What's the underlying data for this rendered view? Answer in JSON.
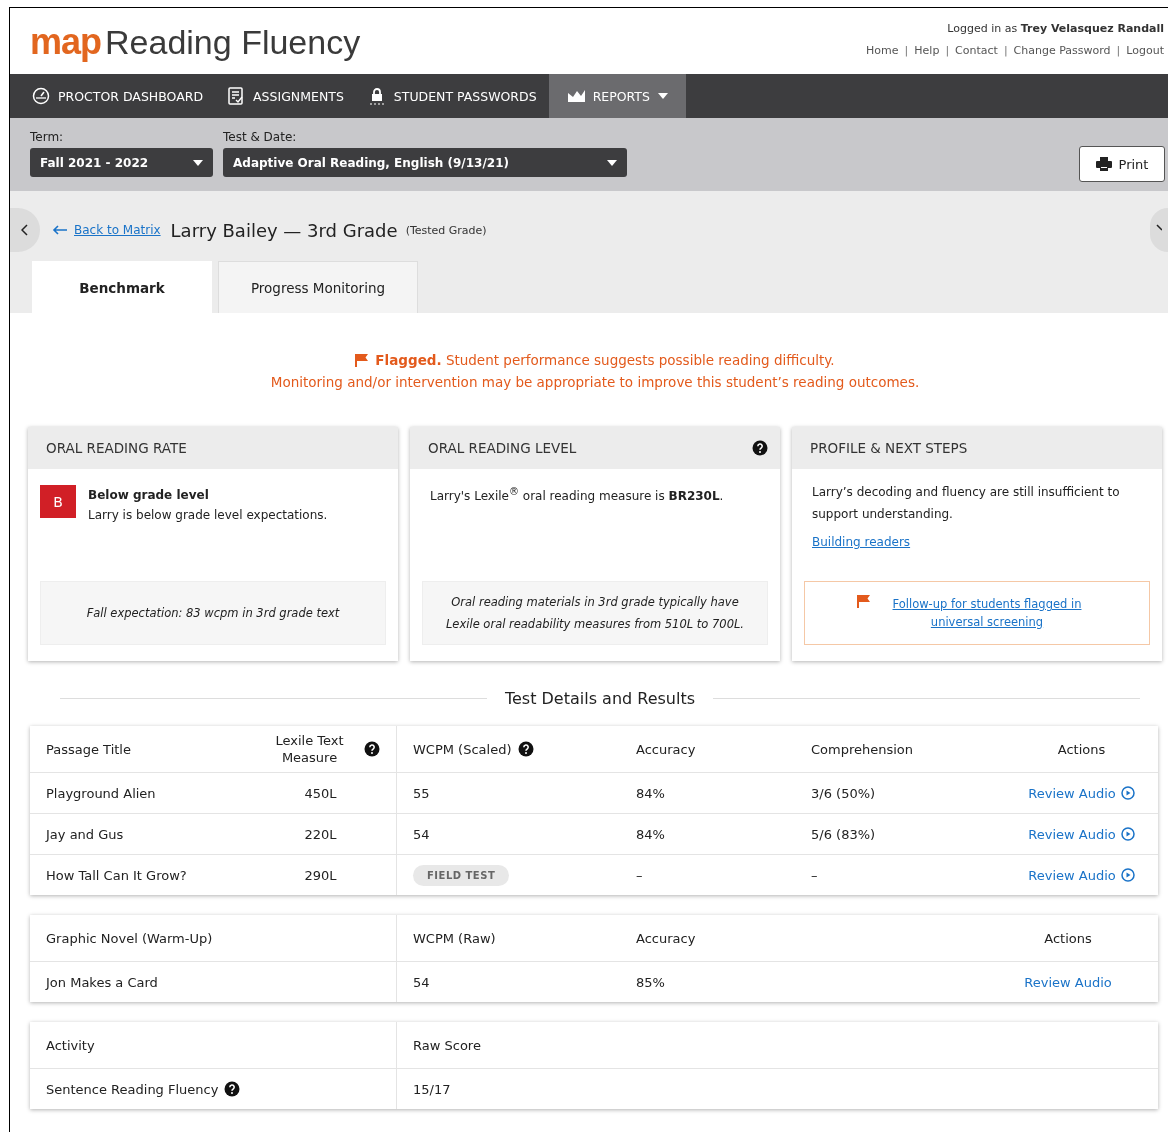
{
  "header": {
    "logo_mark": "map",
    "logo_text": "Reading Fluency",
    "login_prefix": "Logged in as",
    "user": "Trey Velasquez Randall",
    "separator": "|",
    "links": [
      "Home",
      "Help",
      "Contact",
      "Change Password",
      "Logout"
    ]
  },
  "nav": {
    "items": [
      {
        "label": "PROCTOR DASHBOARD",
        "selected": false,
        "dropdown": false
      },
      {
        "label": "ASSIGNMENTS",
        "selected": false,
        "dropdown": false
      },
      {
        "label": "STUDENT PASSWORDS",
        "selected": false,
        "dropdown": false
      },
      {
        "label": "REPORTS",
        "selected": true,
        "dropdown": true
      }
    ]
  },
  "filters": [
    {
      "label": "Term:",
      "value": "Fall 2021 - 2022"
    },
    {
      "label": "Test & Date:",
      "value": "Adaptive Oral Reading, English (9/13/21)"
    }
  ],
  "print_button": "Print",
  "student": {
    "back_link": "Back to Matrix",
    "name": "Larry Bailey — 3rd Grade",
    "note": "(Tested Grade)"
  },
  "tabs": [
    {
      "label": "Benchmark",
      "selected": true
    },
    {
      "label": "Progress Monitoring",
      "selected": false
    }
  ],
  "alert": {
    "lead": "Flagged.",
    "text": "Student performance suggests possible reading difficulty.",
    "line2": "Monitoring and/or intervention may be appropriate to improve this student’s reading outcomes."
  },
  "cards": [
    {
      "title": "ORAL READING RATE",
      "help": false,
      "kind": "rate",
      "badge": "B",
      "status": "Below grade level",
      "text": "Larry is below grade level expectations.",
      "note": "Fall expectation: 83 wcpm in 3rd grade text"
    },
    {
      "title": "ORAL READING LEVEL",
      "help": true,
      "kind": "level",
      "text": "Larry's Lexile$^{®}$ oral reading measure is **BR230L**.",
      "note": "Oral reading materials in 3rd grade typically have Lexile oral readability measures from 510L to 700L."
    },
    {
      "title": "PROFILE & NEXT STEPS",
      "help": false,
      "kind": "profile",
      "text": "Larry’s decoding and fluency are still insufficient to support understanding.",
      "link": "Building readers",
      "note": "Follow-up for students flagged in universal screening"
    }
  ],
  "section_title": "Test Details and Results",
  "tables": [
    {
      "columns": [
        {
          "label": "Passage Title",
          "help": false
        },
        {
          "label": "Lexile Text Measure",
          "help": true
        },
        {
          "label": "WCPM (Scaled)",
          "help": true
        },
        {
          "label": "Accuracy",
          "help": false
        },
        {
          "label": "Comprehension",
          "help": false
        },
        {
          "label": "Actions",
          "help": false
        }
      ],
      "rows": [
        [
          {
            "kind": "text",
            "text": "Playground Alien"
          },
          {
            "kind": "text",
            "text": "450L"
          },
          {
            "kind": "text",
            "text": "55"
          },
          {
            "kind": "text",
            "text": "84%"
          },
          {
            "kind": "text",
            "text": "3/6 (50%)"
          },
          {
            "kind": "play",
            "text": "Review Audio"
          }
        ],
        [
          {
            "kind": "text",
            "text": "Jay and Gus"
          },
          {
            "kind": "text",
            "text": "220L"
          },
          {
            "kind": "text",
            "text": "54"
          },
          {
            "kind": "text",
            "text": "84%"
          },
          {
            "kind": "text",
            "text": "5/6 (83%)"
          },
          {
            "kind": "play",
            "text": "Review Audio"
          }
        ],
        [
          {
            "kind": "text",
            "text": "How Tall Can It Grow?"
          },
          {
            "kind": "text",
            "text": "290L"
          },
          {
            "kind": "badge",
            "text": "FIELD TEST"
          },
          {
            "kind": "text",
            "text": "–"
          },
          {
            "kind": "text",
            "text": "–"
          },
          {
            "kind": "play",
            "text": "Review Audio"
          }
        ]
      ]
    },
    {
      "columns": [
        {
          "label": "Graphic Novel (Warm-Up)",
          "help": false
        },
        {
          "label": "WCPM (Raw)",
          "help": false
        },
        {
          "label": "Accuracy",
          "help": false
        },
        {
          "label": "Actions",
          "help": false
        }
      ],
      "rows": [
        [
          {
            "kind": "text",
            "text": "Jon Makes a Card"
          },
          {
            "kind": "text",
            "text": "54"
          },
          {
            "kind": "text",
            "text": "85%"
          },
          {
            "kind": "link",
            "text": "Review Audio"
          }
        ]
      ]
    },
    {
      "columns": [
        {
          "label": "Activity",
          "help": false
        },
        {
          "label": "Raw Score",
          "help": false
        }
      ],
      "rows": [
        [
          {
            "kind": "help",
            "text": "Sentence Reading Fluency"
          },
          {
            "kind": "text",
            "text": "15/17"
          }
        ]
      ]
    }
  ]
}
